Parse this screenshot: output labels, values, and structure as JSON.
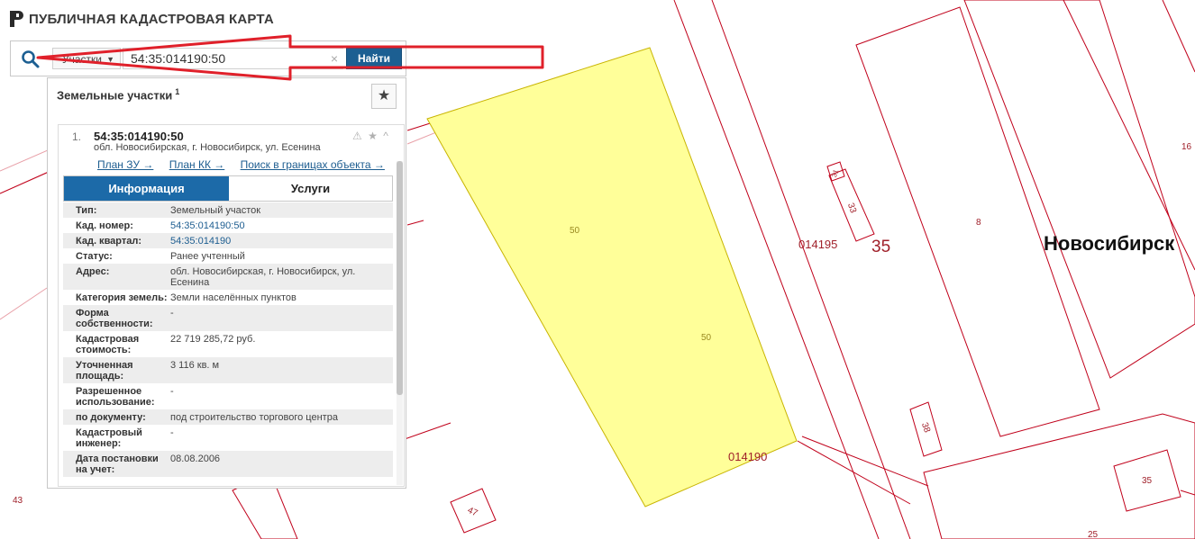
{
  "app": {
    "title": "ПУБЛИЧНАЯ КАДАСТРОВАЯ КАРТА"
  },
  "search": {
    "type_label": "Участки",
    "value": "54:35:014190:50",
    "clear": "×",
    "button_label": "Найти"
  },
  "panel": {
    "title": "Земельные участки",
    "count": "1",
    "favorite": "★"
  },
  "card": {
    "index": "1.",
    "cadastral_id": "54:35:014190:50",
    "address": "обл. Новосибирская, г. Новосибирск, ул. Есенина",
    "action_warn": "⚠",
    "action_star": "★",
    "action_collapse": "^",
    "links": [
      "План ЗУ →",
      "План КК →",
      "Поиск в границах объекта →"
    ],
    "tabs": [
      "Информация",
      "Услуги"
    ],
    "rows": [
      {
        "label": "Тип:",
        "value": "Земельный участок"
      },
      {
        "label": "Кад. номер:",
        "value": "54:35:014190:50"
      },
      {
        "label": "Кад. квартал:",
        "value": "54:35:014190"
      },
      {
        "label": "Статус:",
        "value": "Ранее учтенный"
      },
      {
        "label": "Адрес:",
        "value": "обл. Новосибирская, г. Новосибирск, ул. Есенина"
      },
      {
        "label": "Категория земель:",
        "value": "Земли населённых пунктов"
      },
      {
        "label": "Форма собственности:",
        "value": "-"
      },
      {
        "label": "Кадастровая стоимость:",
        "value": "22 719 285,72 руб."
      },
      {
        "label": "Уточненная площадь:",
        "value": "3 116 кв. м"
      },
      {
        "label": "Разрешенное использование:",
        "value": "-"
      },
      {
        "label": "по документу:",
        "value": "под строительство торгового центра"
      },
      {
        "label": "Кадастровый инженер:",
        "value": "-"
      },
      {
        "label": "Дата постановки на учет:",
        "value": "08.08.2006"
      }
    ]
  },
  "map": {
    "labels": {
      "parcel_a": "50",
      "parcel_b": "50",
      "quarter_a": "014195",
      "quarter_b": "014190",
      "big_num": "35",
      "city": "Новосибирск",
      "n_8": "8",
      "n_16": "16",
      "n_33": "33",
      "n_31": "31",
      "n_38": "38",
      "n_35": "35",
      "n_25": "25",
      "n_47": "47",
      "n_43": "43"
    },
    "colors": {
      "parcel_fill": "#ffff99",
      "parcel_stroke": "#c8b400",
      "boundary": "#c0001a",
      "arrow": "#e0202a"
    }
  }
}
